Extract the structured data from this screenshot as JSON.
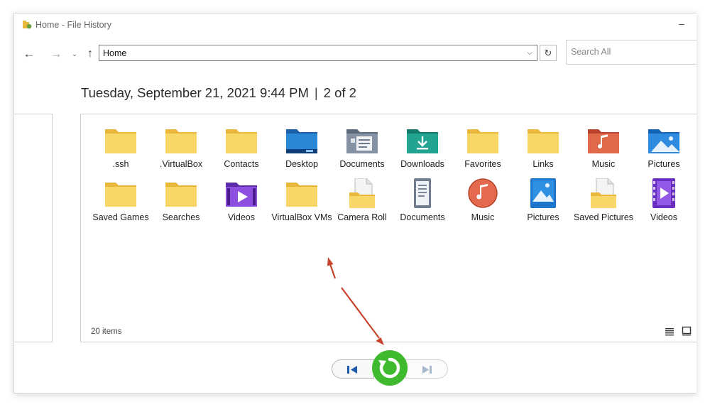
{
  "window": {
    "title": "Home - File History",
    "minimize": "–"
  },
  "nav": {
    "back_icon": "←",
    "forward_icon": "→",
    "recent_icon": "⌄",
    "up_icon": "↑",
    "address": "Home",
    "dropdown_icon": "⌵",
    "refresh_icon": "↻",
    "search_placeholder": "Search All"
  },
  "snapshot": {
    "date": "Tuesday, September 21, 2021 9:44 PM",
    "separator": "|",
    "position": "2 of 2"
  },
  "items": [
    {
      "label": "ssh",
      "display": ".ssh",
      "icon": "folder-icon"
    },
    {
      "label": "VirtualBox",
      "display": ".VirtualBox",
      "icon": "folder-icon"
    },
    {
      "label": "Contacts",
      "display": "Contacts",
      "icon": "folder-icon"
    },
    {
      "label": "Desktop",
      "display": "Desktop",
      "icon": "desktop-folder-icon"
    },
    {
      "label": "Documents",
      "display": "Documents",
      "icon": "documents-folder-icon"
    },
    {
      "label": "Downloads",
      "display": "Downloads",
      "icon": "downloads-folder-icon"
    },
    {
      "label": "Favorites",
      "display": "Favorites",
      "icon": "folder-icon"
    },
    {
      "label": "Links",
      "display": "Links",
      "icon": "folder-icon"
    },
    {
      "label": "Music",
      "display": "Music",
      "icon": "music-folder-icon"
    },
    {
      "label": "Pictures",
      "display": "Pictures",
      "icon": "pictures-folder-icon"
    },
    {
      "label": "Saved Games",
      "display": "Saved Games",
      "icon": "folder-icon"
    },
    {
      "label": "Searches",
      "display": "Searches",
      "icon": "folder-icon"
    },
    {
      "label": "Videos",
      "display": "Videos",
      "icon": "videos-folder-icon"
    },
    {
      "label": "VirtualBox VMs",
      "display": "VirtualBox VMs",
      "icon": "folder-icon"
    },
    {
      "label": "Camera Roll",
      "display": "Camera Roll",
      "icon": "library-camera-roll-icon"
    },
    {
      "label": "Documents",
      "display": "Documents",
      "icon": "library-documents-icon"
    },
    {
      "label": "Music",
      "display": "Music",
      "icon": "library-music-icon"
    },
    {
      "label": "Pictures",
      "display": "Pictures",
      "icon": "library-pictures-icon"
    },
    {
      "label": "Saved Pictures",
      "display": "Saved Pictures",
      "icon": "library-saved-pictures-icon"
    },
    {
      "label": "Videos",
      "display": "Videos",
      "icon": "library-videos-icon"
    }
  ],
  "status": {
    "count": "20 items"
  },
  "colors": {
    "folder": "#f7cf4d",
    "restore_green": "#3fba2f",
    "annotation_arrow": "#c8432b"
  }
}
